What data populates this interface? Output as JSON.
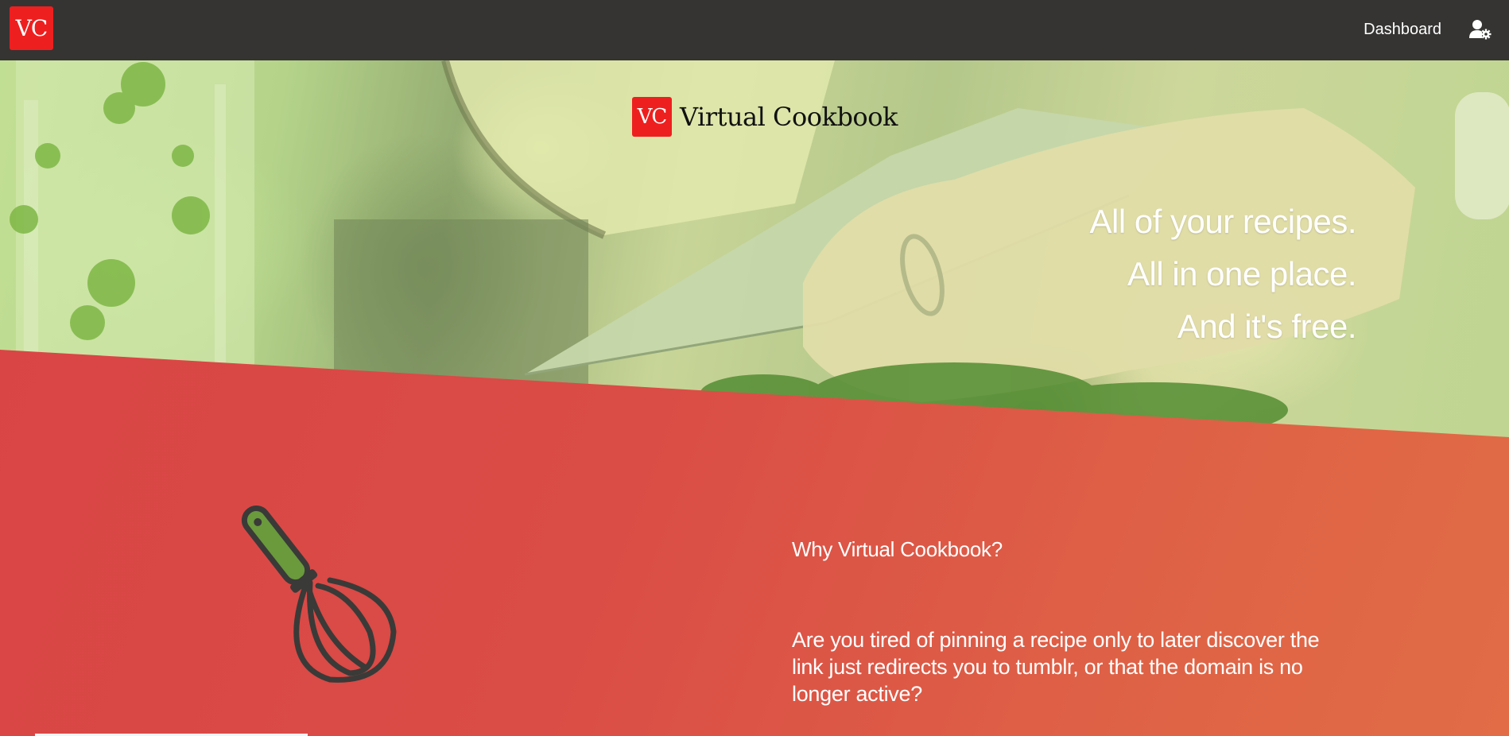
{
  "navbar": {
    "logo_text": "VC",
    "dashboard_label": "Dashboard",
    "user_settings_icon": "user-gear-icon",
    "background_color": "#353432"
  },
  "hero": {
    "brand_logo_text": "VC",
    "brand_name": "Virtual Cookbook",
    "taglines": [
      "All of your recipes.",
      "All in one place.",
      "And it's free."
    ]
  },
  "features": {
    "icon": "whisk-icon",
    "title": "Why Virtual Cookbook?",
    "body": "Are you tired of pinning a recipe only to later discover the link just redirects you to tumblr, or that the domain is no longer active?",
    "background_color": "#da4c46"
  },
  "colors": {
    "brand_red": "#ee1f1f",
    "whisk_handle": "#6a9a3c",
    "whisk_outline": "#3a3a38"
  }
}
